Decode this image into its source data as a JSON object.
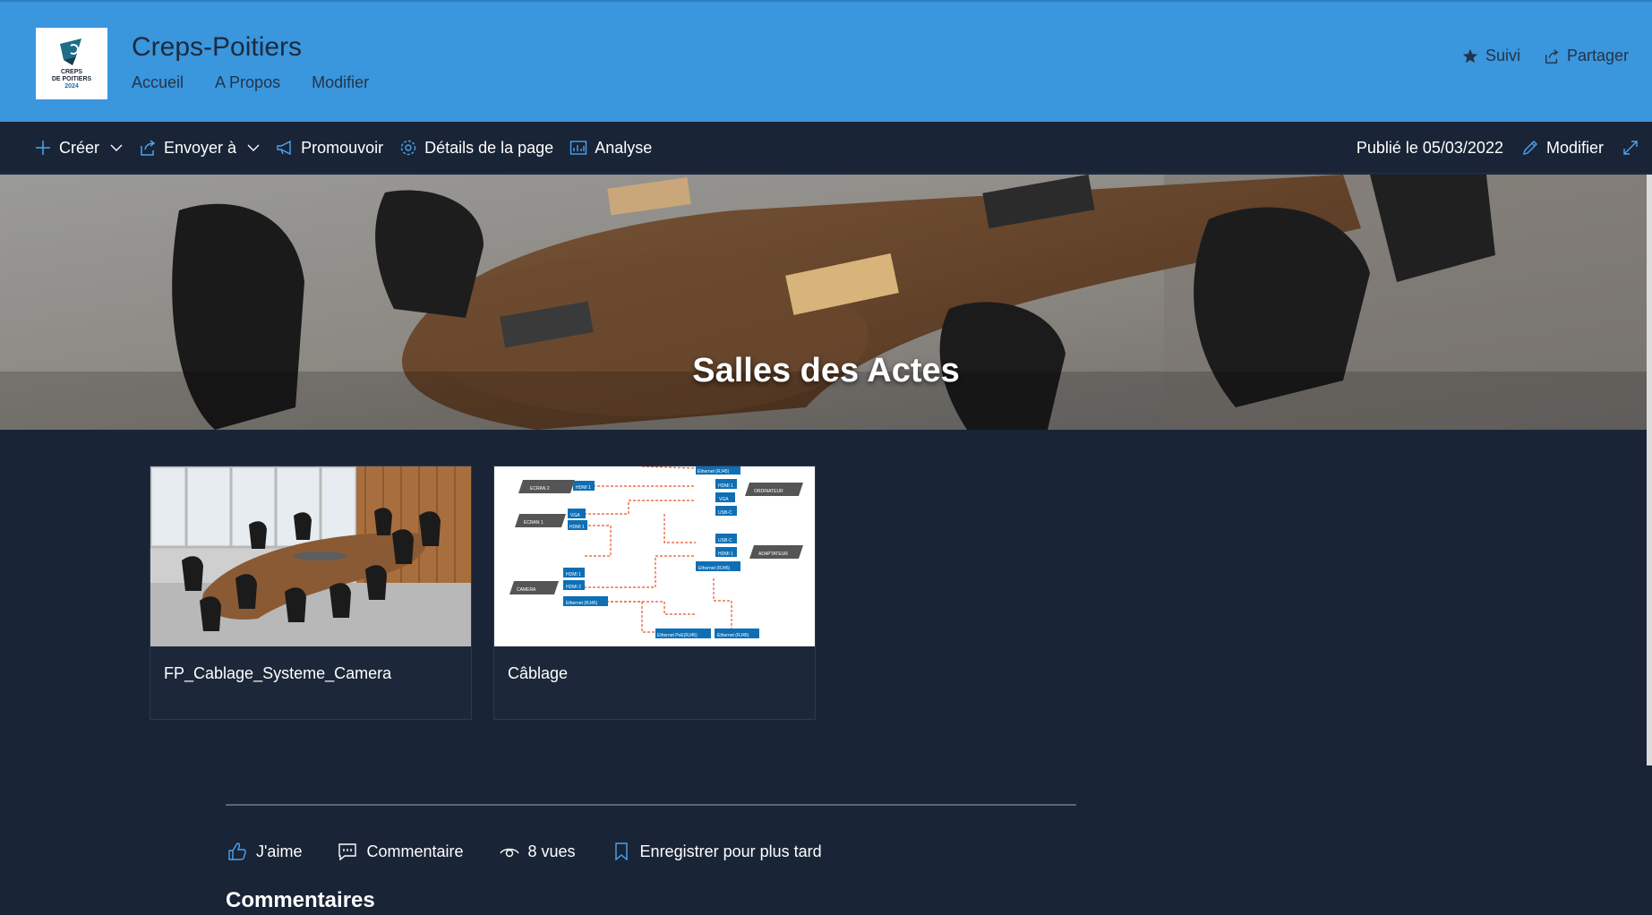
{
  "site": {
    "title": "Creps-Poitiers",
    "logo_text_line1": "CREPS",
    "logo_text_line2": "DE POITIERS",
    "logo_year": "2024",
    "nav": [
      "Accueil",
      "A Propos",
      "Modifier"
    ],
    "follow_label": "Suivi",
    "share_label": "Partager"
  },
  "command_bar": {
    "create_label": "Créer",
    "send_label": "Envoyer à",
    "promote_label": "Promouvoir",
    "details_label": "Détails de la page",
    "analytics_label": "Analyse",
    "published_label": "Publié le 05/03/2022",
    "edit_label": "Modifier"
  },
  "hero": {
    "title": "Salles des Actes"
  },
  "cards": [
    {
      "title": "FP_Cablage_Systeme_Camera"
    },
    {
      "title": "Câblage"
    }
  ],
  "diagram": {
    "labels": [
      "ECRAN 2",
      "ECRAN 1",
      "CAMERA",
      "ORDINATEUR",
      "ADAPTATEUR",
      "HDMI 1",
      "VGA",
      "HDMI 1",
      "HDMI 1",
      "HDMI 2",
      "Ethernet (RJ45)",
      "Ethernet (RJ45)",
      "HDMI 1",
      "VGA",
      "USB-C",
      "USB-C",
      "HDMI 1",
      "Ethernet (RJ45)",
      "Ethernet PoE(RJ45)",
      "Ethernet (RJ45)"
    ]
  },
  "social": {
    "like_label": "J'aime",
    "comment_label": "Commentaire",
    "views_label": "8 vues",
    "save_label": "Enregistrer pour plus tard"
  },
  "comments_heading": "Commentaires",
  "colors": {
    "header_bg": "#3a96dd",
    "page_bg": "#192436",
    "accent": "#0078d4"
  }
}
